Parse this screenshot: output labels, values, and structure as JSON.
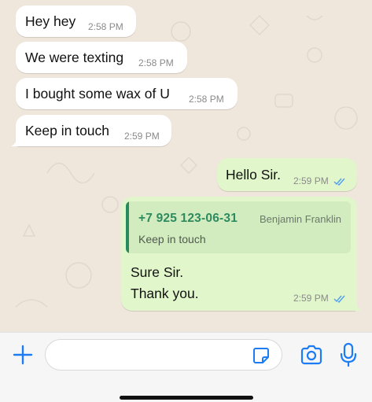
{
  "messages": {
    "incoming": [
      {
        "text": "Hey hey",
        "time": "2:58 PM"
      },
      {
        "text": "We were texting",
        "time": "2:58 PM"
      },
      {
        "text": "I bought some wax of U",
        "time": "2:58 PM"
      },
      {
        "text": "Keep in touch",
        "time": "2:59 PM"
      }
    ],
    "outgoing": [
      {
        "text": "Hello Sir.",
        "time": "2:59 PM",
        "status": "read"
      },
      {
        "reply": {
          "phone": "+7 925 123-06-31",
          "name": "Benjamin Franklin",
          "text": "Keep in touch"
        },
        "lines": [
          "Sure Sir.",
          "Thank you."
        ],
        "time": "2:59 PM",
        "status": "read"
      }
    ]
  },
  "composer": {
    "placeholder": "",
    "value": ""
  },
  "icons": {
    "attach": "plus-icon",
    "sticker": "sticker-icon",
    "camera": "camera-icon",
    "mic": "microphone-icon",
    "read_receipt": "double-check-icon"
  },
  "colors": {
    "incoming_bubble": "#ffffff",
    "outgoing_bubble": "#e1f7cb",
    "accent_blue": "#1c7cf4",
    "reply_green": "#2e8a5f",
    "read_ticks": "#4f9df0"
  }
}
